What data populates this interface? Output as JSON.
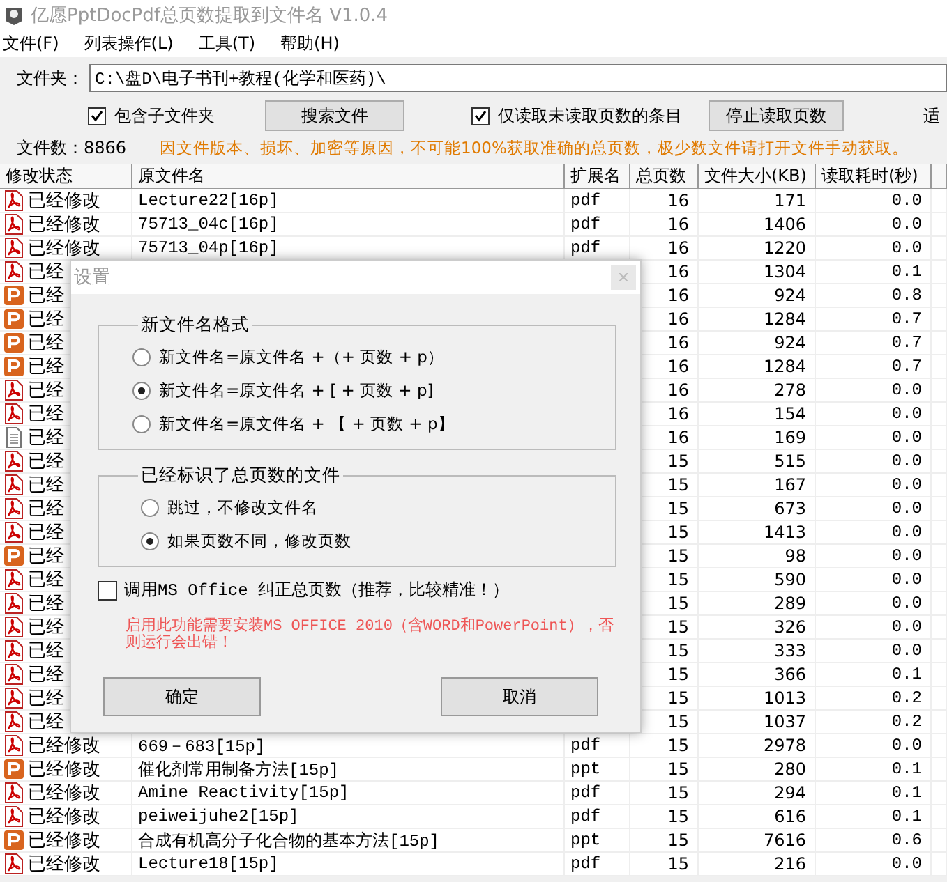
{
  "window": {
    "title": "亿愿PptDocPdf总页数提取到文件名 V1.0.4"
  },
  "menu": [
    "文件(F)",
    "列表操作(L)",
    "工具(T)",
    "帮助(H)"
  ],
  "folder": {
    "label": "文件夹：",
    "value": "C:\\盘D\\电子书刊+教程(化学和医药)\\"
  },
  "options": [
    {
      "kind": "checkbox",
      "label": "包含子文件夹",
      "checked": true
    },
    {
      "kind": "button",
      "label": "搜索文件"
    },
    {
      "kind": "checkbox",
      "label": "仅读取未读取页数的条目",
      "checked": true
    },
    {
      "kind": "button",
      "label": "停止读取页数"
    },
    {
      "kind": "text",
      "label": "适"
    }
  ],
  "file_count": "文件数：8866",
  "notice": "因文件版本、损坏、加密等原因，不可能100%获取准确的总页数，极少数文件请打开文件手动获取。",
  "table": {
    "columns": [
      "修改状态",
      "原文件名",
      "扩展名",
      "总页数",
      "文件大小(KB)",
      "读取耗时(秒)"
    ],
    "rows": [
      {
        "kind": "pdf",
        "status": "已经修改",
        "name": "Lecture22[16p]",
        "ext": "pdf",
        "pages": "16",
        "size": "171",
        "time": "0.0"
      },
      {
        "kind": "pdf",
        "status": "已经修改",
        "name": "75713_04c[16p]",
        "ext": "pdf",
        "pages": "16",
        "size": "1406",
        "time": "0.0"
      },
      {
        "kind": "pdf",
        "status": "已经修改",
        "name": "75713_04p[16p]",
        "ext": "pdf",
        "pages": "16",
        "size": "1220",
        "time": "0.0"
      },
      {
        "kind": "pdf",
        "status": "已经",
        "pages": "16",
        "size": "1304",
        "time": "0.1"
      },
      {
        "kind": "ppt",
        "status": "已经",
        "pages": "16",
        "size": "924",
        "time": "0.8"
      },
      {
        "kind": "ppt",
        "status": "已经",
        "pages": "16",
        "size": "1284",
        "time": "0.7"
      },
      {
        "kind": "ppt",
        "status": "已经",
        "pages": "16",
        "size": "924",
        "time": "0.7"
      },
      {
        "kind": "ppt",
        "status": "已经",
        "pages": "16",
        "size": "1284",
        "time": "0.7"
      },
      {
        "kind": "pdf",
        "status": "已经",
        "pages": "16",
        "size": "278",
        "time": "0.0"
      },
      {
        "kind": "pdf",
        "status": "已经",
        "pages": "16",
        "size": "154",
        "time": "0.0"
      },
      {
        "kind": "txt",
        "status": "已经",
        "pages": "16",
        "size": "169",
        "time": "0.0"
      },
      {
        "kind": "pdf",
        "status": "已经",
        "pages": "15",
        "size": "515",
        "time": "0.0"
      },
      {
        "kind": "pdf",
        "status": "已经",
        "pages": "15",
        "size": "167",
        "time": "0.0"
      },
      {
        "kind": "pdf",
        "status": "已经",
        "pages": "15",
        "size": "673",
        "time": "0.0"
      },
      {
        "kind": "pdf",
        "status": "已经",
        "pages": "15",
        "size": "1413",
        "time": "0.0"
      },
      {
        "kind": "ppt",
        "status": "已经",
        "pages": "15",
        "size": "98",
        "time": "0.0"
      },
      {
        "kind": "pdf",
        "status": "已经",
        "pages": "15",
        "size": "590",
        "time": "0.0"
      },
      {
        "kind": "pdf",
        "status": "已经",
        "pages": "15",
        "size": "289",
        "time": "0.0"
      },
      {
        "kind": "pdf",
        "status": "已经",
        "pages": "15",
        "size": "326",
        "time": "0.0"
      },
      {
        "kind": "pdf",
        "status": "已经",
        "pages": "15",
        "size": "333",
        "time": "0.0"
      },
      {
        "kind": "pdf",
        "status": "已经",
        "pages": "15",
        "size": "366",
        "time": "0.1"
      },
      {
        "kind": "pdf",
        "status": "已经",
        "pages": "15",
        "size": "1013",
        "time": "0.2"
      },
      {
        "kind": "pdf",
        "status": "已经",
        "pages": "15",
        "size": "1037",
        "time": "0.2"
      },
      {
        "kind": "pdf",
        "status": "已经修改",
        "name": "669－683[15p]",
        "ext": "pdf",
        "pages": "15",
        "size": "2978",
        "time": "0.0"
      },
      {
        "kind": "ppt",
        "status": "已经修改",
        "name": "催化剂常用制备方法[15p]",
        "ext": "ppt",
        "pages": "15",
        "size": "280",
        "time": "0.1"
      },
      {
        "kind": "pdf",
        "status": "已经修改",
        "name": "Amine Reactivity[15p]",
        "ext": "pdf",
        "pages": "15",
        "size": "294",
        "time": "0.1"
      },
      {
        "kind": "pdf",
        "status": "已经修改",
        "name": "peiweijuhe2[15p]",
        "ext": "pdf",
        "pages": "15",
        "size": "616",
        "time": "0.1"
      },
      {
        "kind": "ppt",
        "status": "已经修改",
        "name": "合成有机高分子化合物的基本方法[15p]",
        "ext": "ppt",
        "pages": "15",
        "size": "7616",
        "time": "0.6"
      },
      {
        "kind": "pdf",
        "status": "已经修改",
        "name": "Lecture18[15p]",
        "ext": "pdf",
        "pages": "15",
        "size": "216",
        "time": "0.0"
      }
    ]
  },
  "dialog": {
    "title": "设置",
    "groups": [
      {
        "title": "新文件名格式",
        "options": [
          {
            "label": "新文件名=原文件名 +（+ 页数 + p）",
            "selected": false
          },
          {
            "label": "新文件名=原文件名 + [ + 页数 + p]",
            "selected": true
          },
          {
            "label": "新文件名=原文件名 + 【 + 页数 + p】",
            "selected": false
          }
        ]
      },
      {
        "title": "已经标识了总页数的文件",
        "options": [
          {
            "label": "跳过，不修改文件名",
            "selected": false
          },
          {
            "label": "如果页数不同，修改页数",
            "selected": true
          }
        ]
      }
    ],
    "office_check": {
      "label": "调用MS Office 纠正总页数（推荐，比较精准！）",
      "checked": false
    },
    "warning": "启用此功能需要安装MS OFFICE 2010（含WORD和PowerPoint），否则运行会出错！",
    "buttons": [
      "确定",
      "取消"
    ]
  }
}
